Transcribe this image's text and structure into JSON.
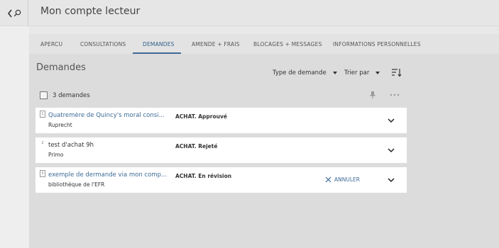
{
  "header": {
    "title": "Mon compte lecteur",
    "back_icon": "chevron-left-icon",
    "search_icon": "search-icon"
  },
  "tabs": [
    {
      "label": "APERCU",
      "active": false
    },
    {
      "label": "CONSULTATIONS",
      "active": false
    },
    {
      "label": "DEMANDES",
      "active": true
    },
    {
      "label": "AMENDE + FRAIS",
      "active": false
    },
    {
      "label": "BLOCAGES + MESSAGES",
      "active": false
    },
    {
      "label": "INFORMATIONS PERSONNELLES",
      "active": false
    }
  ],
  "section": {
    "title": "Demandes",
    "type_filter": "Type de demande",
    "sort_label": "Trier par",
    "count_label": "3 demandes"
  },
  "requests": [
    {
      "num": "1",
      "title": "Quatremère de Quincy's moral consi...",
      "subtitle": "Ruprecht",
      "status": "ACHAT. Approuvé",
      "action": ""
    },
    {
      "num": "2",
      "title": "test d'achat 9h",
      "subtitle": "Primo",
      "status": "ACHAT. Rejeté",
      "action": ""
    },
    {
      "num": "3",
      "title": "exemple de dermande via mon comp...",
      "subtitle": "bibliothèque de l'EFR",
      "status": "ACHAT. En révision",
      "action": "ANNULER"
    }
  ],
  "colors": {
    "accent": "#3d6b96",
    "background": "#dcdcdc",
    "card": "#ffffff"
  }
}
